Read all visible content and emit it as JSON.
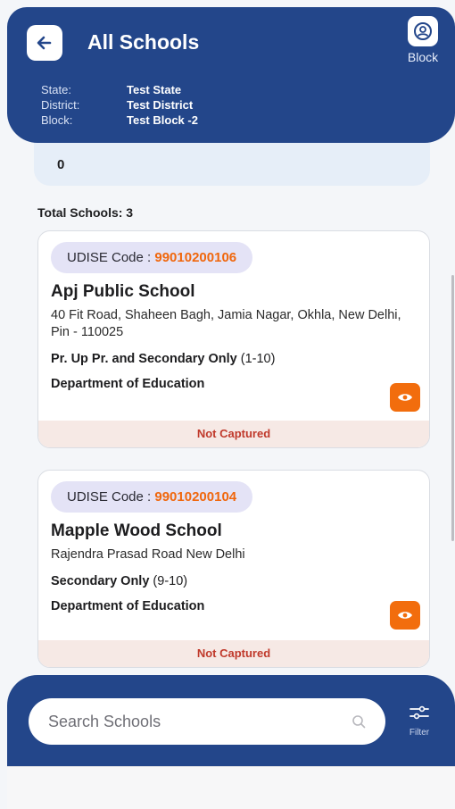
{
  "header": {
    "title": "All Schools",
    "profile_label": "Block",
    "meta": [
      {
        "key": "State:",
        "value": "Test State"
      },
      {
        "key": "District:",
        "value": "Test District"
      },
      {
        "key": "Block:",
        "value": "Test Block -2"
      }
    ]
  },
  "summary": {
    "top_value": "0",
    "total_label": "Total Schools: 3"
  },
  "schools": [
    {
      "udise_label": "UDISE Code : ",
      "udise_code": "99010200106",
      "name": "Apj Public School",
      "address": "40 Fit Road, Shaheen Bagh, Jamia Nagar, Okhla, New Delhi, Pin - 110025",
      "category": "Pr. Up Pr. and Secondary Only",
      "grades": " (1-10)",
      "department": "Department of Education",
      "status": "Not Captured"
    },
    {
      "udise_label": "UDISE Code : ",
      "udise_code": "99010200104",
      "name": "Mapple Wood School",
      "address": "Rajendra Prasad Road New Delhi",
      "category": "Secondary Only",
      "grades": " (9-10)",
      "department": "Department of Education",
      "status": "Not Captured"
    }
  ],
  "search": {
    "placeholder": "Search Schools",
    "value": ""
  },
  "filter": {
    "label": "Filter"
  },
  "icons": {
    "back": "arrow-left-icon",
    "profile": "user-circle-icon",
    "view": "eye-icon",
    "search": "search-icon",
    "filter": "sliders-icon"
  },
  "colors": {
    "primary": "#23468a",
    "accent": "#f26d0d",
    "status": "#c0392b"
  }
}
